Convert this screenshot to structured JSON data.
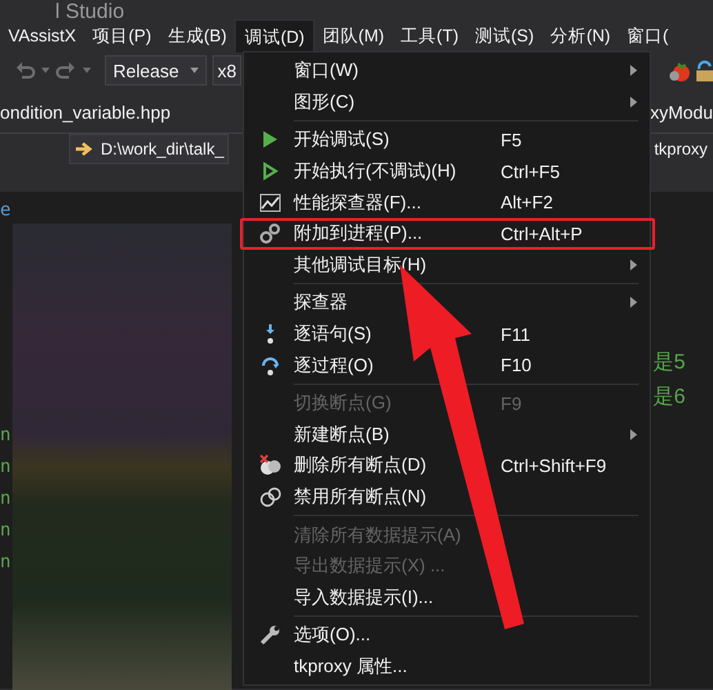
{
  "window": {
    "title": "l Studio"
  },
  "menu_bar": [
    {
      "label": "VAssistX",
      "selected": false
    },
    {
      "label": "项目(P)",
      "selected": false
    },
    {
      "label": "生成(B)",
      "selected": false
    },
    {
      "label": "调试(D)",
      "selected": true
    },
    {
      "label": "团队(M)",
      "selected": false
    },
    {
      "label": "工具(T)",
      "selected": false
    },
    {
      "label": "测试(S)",
      "selected": false
    },
    {
      "label": "分析(N)",
      "selected": false
    },
    {
      "label": "窗口(",
      "selected": false
    }
  ],
  "toolbar": {
    "configuration": "Release",
    "platform": "x8"
  },
  "tabs": [
    {
      "label": "ondition_variable.hpp"
    },
    {
      "label": "xyModu"
    }
  ],
  "path_bar": {
    "path": "D:\\work_dir\\talk_",
    "project": "tkproxy"
  },
  "editor": {
    "left_fragments": [
      "e",
      "n",
      "n",
      "n",
      "n",
      "n"
    ],
    "right_fragments": [
      "是5",
      "是6"
    ]
  },
  "debug_menu": [
    {
      "kind": "item",
      "label": "窗口(W)",
      "submenu": true,
      "disabled": false,
      "annotated": false
    },
    {
      "kind": "item",
      "label": "图形(C)",
      "submenu": true,
      "disabled": false,
      "annotated": false
    },
    {
      "kind": "separator"
    },
    {
      "kind": "item",
      "label": "开始调试(S)",
      "shortcut": "F5",
      "disabled": false,
      "annotated": false
    },
    {
      "kind": "item",
      "label": "开始执行(不调试)(H)",
      "shortcut": "Ctrl+F5",
      "disabled": false,
      "annotated": false
    },
    {
      "kind": "item",
      "label": "性能探查器(F)...",
      "shortcut": "Alt+F2",
      "disabled": false,
      "annotated": false
    },
    {
      "kind": "item",
      "label": "附加到进程(P)...",
      "shortcut": "Ctrl+Alt+P",
      "disabled": false,
      "annotated": true
    },
    {
      "kind": "item",
      "label": "其他调试目标(H)",
      "submenu": true,
      "disabled": false,
      "annotated": false
    },
    {
      "kind": "separator"
    },
    {
      "kind": "item",
      "label": "探查器",
      "submenu": true,
      "disabled": false,
      "annotated": false
    },
    {
      "kind": "item",
      "label": "逐语句(S)",
      "shortcut": "F11",
      "disabled": false,
      "annotated": false
    },
    {
      "kind": "item",
      "label": "逐过程(O)",
      "shortcut": "F10",
      "disabled": false,
      "annotated": false
    },
    {
      "kind": "separator"
    },
    {
      "kind": "item",
      "label": "切换断点(G)",
      "shortcut": "F9",
      "disabled": true,
      "annotated": false
    },
    {
      "kind": "item",
      "label": "新建断点(B)",
      "submenu": true,
      "disabled": false,
      "annotated": false
    },
    {
      "kind": "item",
      "label": "删除所有断点(D)",
      "shortcut": "Ctrl+Shift+F9",
      "disabled": false,
      "annotated": false
    },
    {
      "kind": "item",
      "label": "禁用所有断点(N)",
      "disabled": false,
      "annotated": false
    },
    {
      "kind": "separator"
    },
    {
      "kind": "item",
      "label": "清除所有数据提示(A)",
      "disabled": true,
      "annotated": false
    },
    {
      "kind": "item",
      "label": "导出数据提示(X) ...",
      "disabled": true,
      "annotated": false
    },
    {
      "kind": "item",
      "label": "导入数据提示(I)...",
      "disabled": false,
      "annotated": false
    },
    {
      "kind": "separator"
    },
    {
      "kind": "item",
      "label": "选项(O)...",
      "disabled": false,
      "annotated": false
    },
    {
      "kind": "item",
      "label": "tkproxy 属性...",
      "disabled": false,
      "annotated": false
    }
  ]
}
